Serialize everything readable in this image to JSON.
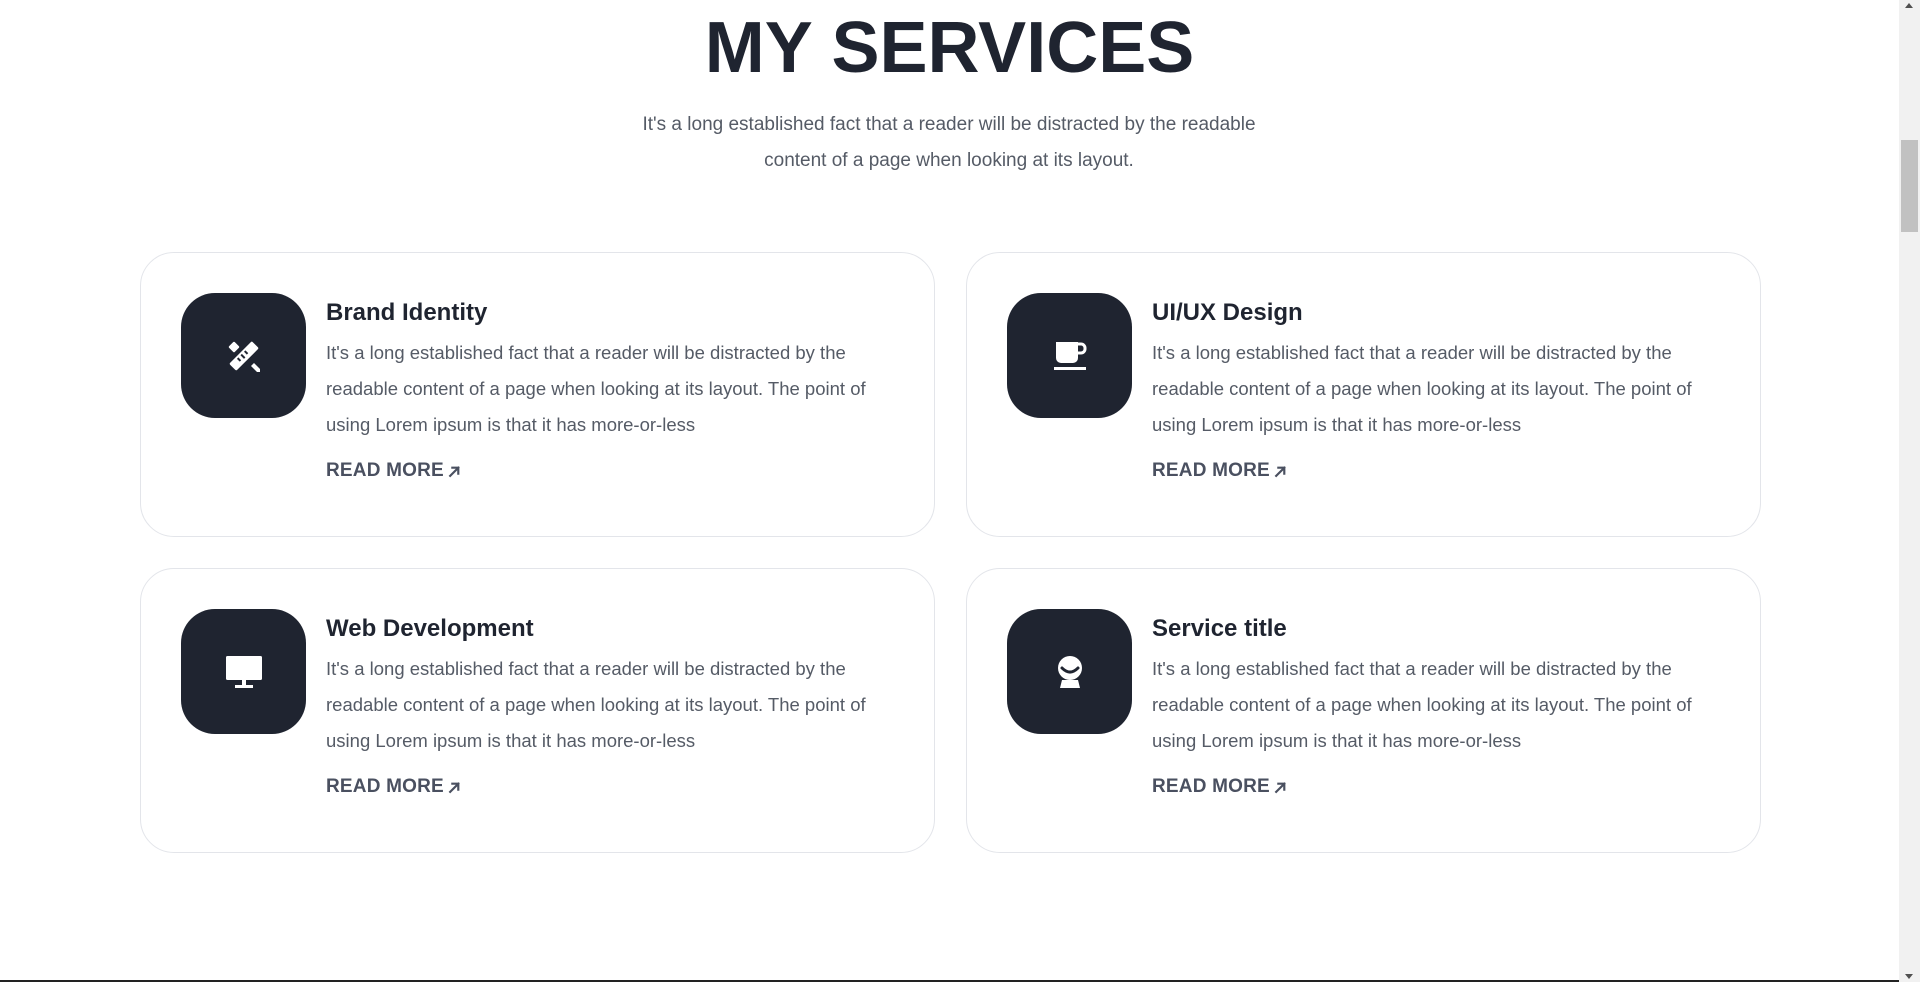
{
  "section": {
    "title": "MY SERVICES",
    "subtitle": "It's a long established fact that a reader will be distracted by the readable content of a page when looking at its layout."
  },
  "services": [
    {
      "title": "Brand Identity",
      "text": "It's a long established fact that a reader will be distracted by the readable content of a page when looking at its layout. The point of using Lorem ipsum is that it has more-or-less",
      "link": "READ MORE",
      "icon": "ruler-pencil-icon"
    },
    {
      "title": "UI/UX Design",
      "text": "It's a long established fact that a reader will be distracted by the readable content of a page when looking at its layout. The point of using Lorem ipsum is that it has more-or-less",
      "link": "READ MORE",
      "icon": "coffee-cup-icon"
    },
    {
      "title": "Web Development",
      "text": "It's a long established fact that a reader will be distracted by the readable content of a page when looking at its layout. The point of using Lorem ipsum is that it has more-or-less",
      "link": "READ MORE",
      "icon": "monitor-icon"
    },
    {
      "title": "Service title",
      "text": "It's a long established fact that a reader will be distracted by the readable content of a page when looking at its layout. The point of using Lorem ipsum is that it has more-or-less",
      "link": "READ MORE",
      "icon": "user-icon"
    }
  ],
  "colors": {
    "heading": "#1f2430",
    "body_text": "#555b66",
    "icon_bg": "#1f2430",
    "card_border": "#e3e5ea"
  }
}
